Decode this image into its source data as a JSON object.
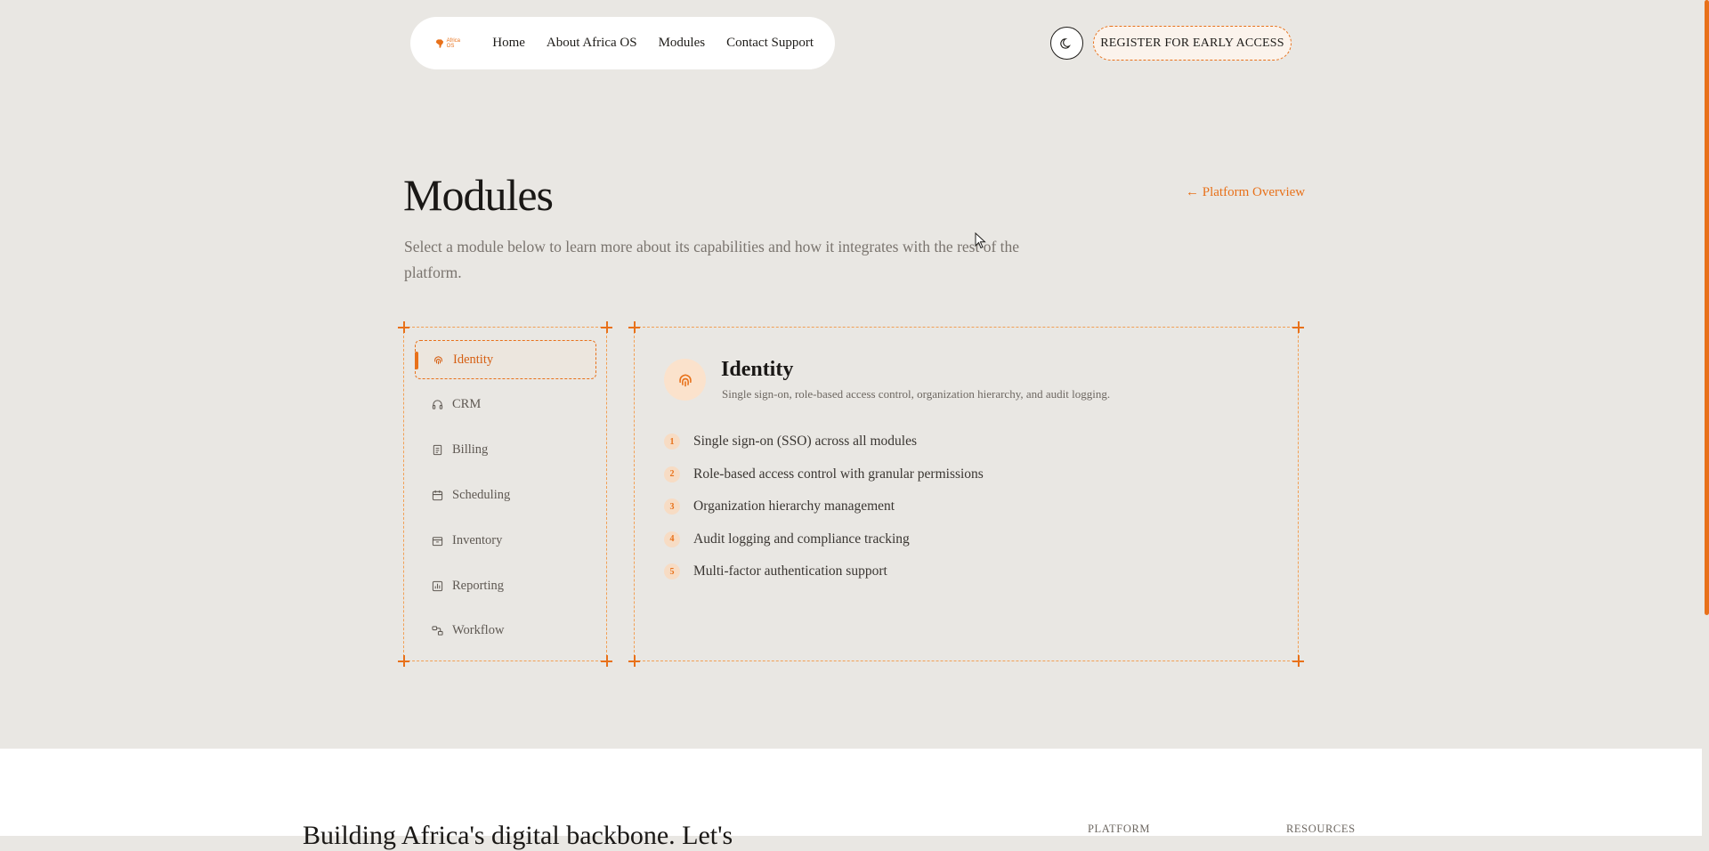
{
  "nav": {
    "logo_text": "Africa OS",
    "links": [
      "Home",
      "About Africa OS",
      "Modules",
      "Contact Support"
    ],
    "register_label": "REGISTER FOR EARLY ACCESS"
  },
  "header": {
    "title": "Modules",
    "subtitle": "Select a module below to learn more about its capabilities and how it integrates with the rest of the platform.",
    "back_link": "← Platform Overview"
  },
  "sidebar": {
    "items": [
      {
        "label": "Identity",
        "icon": "fingerprint-icon",
        "active": true
      },
      {
        "label": "CRM",
        "icon": "headset-icon",
        "active": false
      },
      {
        "label": "Billing",
        "icon": "receipt-icon",
        "active": false
      },
      {
        "label": "Scheduling",
        "icon": "calendar-icon",
        "active": false
      },
      {
        "label": "Inventory",
        "icon": "package-icon",
        "active": false
      },
      {
        "label": "Reporting",
        "icon": "bar-chart-icon",
        "active": false
      },
      {
        "label": "Workflow",
        "icon": "workflow-icon",
        "active": false
      }
    ]
  },
  "detail": {
    "icon": "fingerprint-icon",
    "title": "Identity",
    "description": "Single sign-on, role-based access control, organization hierarchy, and audit logging.",
    "features": [
      {
        "num": "1",
        "text": "Single sign-on (SSO) across all modules"
      },
      {
        "num": "2",
        "text": "Role-based access control with granular permissions"
      },
      {
        "num": "3",
        "text": "Organization hierarchy management"
      },
      {
        "num": "4",
        "text": "Audit logging and compliance tracking"
      },
      {
        "num": "5",
        "text": "Multi-factor authentication support"
      }
    ]
  },
  "footer": {
    "heading": "Building Africa's digital backbone. Let's",
    "col_platform": "PLATFORM",
    "col_resources": "RESOURCES"
  },
  "colors": {
    "accent": "#e8711a",
    "background": "#e9e7e3",
    "text": "#1f1d1a"
  }
}
